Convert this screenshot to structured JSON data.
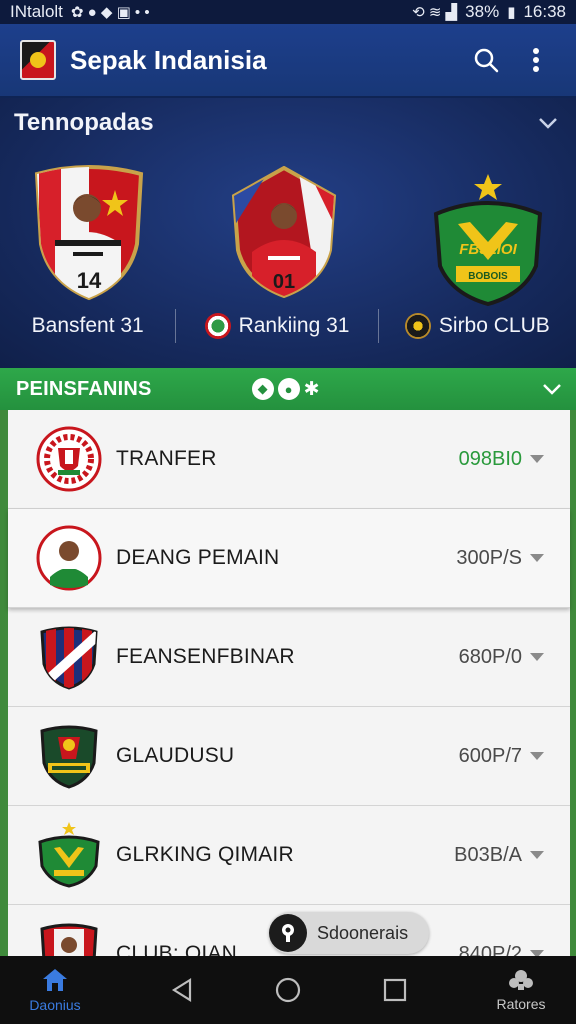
{
  "status_bar": {
    "carrier": "INtalolt",
    "battery": "38%",
    "time": "16:38"
  },
  "app_bar": {
    "title": "Sepak Indanisia"
  },
  "featured": {
    "title": "Tennopadas",
    "crest_numbers": [
      "14",
      "01"
    ],
    "crest_3_text": "FBJLIOI",
    "crest_3_subtext": "BOBOIS",
    "labels": [
      "Bansfent 31",
      "Rankiing 31",
      "Sirbo CLUB"
    ]
  },
  "section": {
    "title": "PEINSFANINS"
  },
  "list": {
    "items": [
      {
        "label": "TRANFER",
        "value": "098BI0",
        "highlight": true
      },
      {
        "label": "DEANG PEMAIN",
        "value": "300P/S",
        "highlight": false
      },
      {
        "label": "FEANSENFBINAR",
        "value": "680P/0",
        "highlight": false
      },
      {
        "label": "GLAUDUSU",
        "value": "600P/7",
        "highlight": false
      },
      {
        "label": "GLRKING QIMAIR",
        "value": "B03B/A",
        "highlight": false
      },
      {
        "label": "CLUB: OIAN",
        "value": "840P/2",
        "highlight": false
      }
    ]
  },
  "chip": {
    "label": "Sdoonerais"
  },
  "bottom_nav": {
    "left_label": "Daonius",
    "right_label": "Ratores"
  },
  "colors": {
    "app_bar": "#1d3f8c",
    "green_bar": "#2ea84a",
    "value_highlight": "#2a9a3c",
    "nav_active": "#3a7be0"
  }
}
